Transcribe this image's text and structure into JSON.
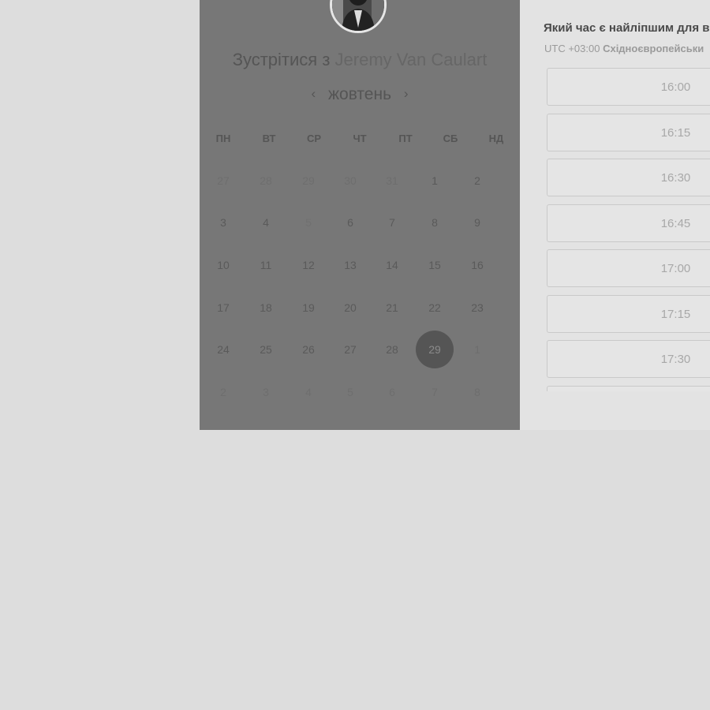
{
  "host": {
    "avatar_alt": "avatar",
    "title_prefix": "Зустрітися з",
    "name": "Jeremy Van Caulart"
  },
  "calendar": {
    "month": "жовтень",
    "prev_icon": "chevron-left-icon",
    "next_icon": "chevron-right-icon",
    "weekdays": [
      "ПН",
      "ВТ",
      "СР",
      "ЧТ",
      "ПТ",
      "СБ",
      "НД"
    ],
    "weeks": [
      [
        {
          "d": "27",
          "s": "muted"
        },
        {
          "d": "28",
          "s": "muted"
        },
        {
          "d": "29",
          "s": "muted"
        },
        {
          "d": "30",
          "s": "muted"
        },
        {
          "d": "31",
          "s": "muted"
        },
        {
          "d": "1",
          "s": ""
        },
        {
          "d": "2",
          "s": ""
        }
      ],
      [
        {
          "d": "3",
          "s": ""
        },
        {
          "d": "4",
          "s": ""
        },
        {
          "d": "5",
          "s": "disabled"
        },
        {
          "d": "6",
          "s": ""
        },
        {
          "d": "7",
          "s": ""
        },
        {
          "d": "8",
          "s": ""
        },
        {
          "d": "9",
          "s": ""
        }
      ],
      [
        {
          "d": "10",
          "s": ""
        },
        {
          "d": "11",
          "s": ""
        },
        {
          "d": "12",
          "s": ""
        },
        {
          "d": "13",
          "s": ""
        },
        {
          "d": "14",
          "s": ""
        },
        {
          "d": "15",
          "s": ""
        },
        {
          "d": "16",
          "s": ""
        }
      ],
      [
        {
          "d": "17",
          "s": ""
        },
        {
          "d": "18",
          "s": ""
        },
        {
          "d": "19",
          "s": ""
        },
        {
          "d": "20",
          "s": ""
        },
        {
          "d": "21",
          "s": ""
        },
        {
          "d": "22",
          "s": ""
        },
        {
          "d": "23",
          "s": ""
        }
      ],
      [
        {
          "d": "24",
          "s": ""
        },
        {
          "d": "25",
          "s": ""
        },
        {
          "d": "26",
          "s": ""
        },
        {
          "d": "27",
          "s": ""
        },
        {
          "d": "28",
          "s": ""
        },
        {
          "d": "29",
          "s": "selected"
        },
        {
          "d": "1",
          "s": "muted"
        }
      ],
      [
        {
          "d": "2",
          "s": "muted"
        },
        {
          "d": "3",
          "s": "muted"
        },
        {
          "d": "4",
          "s": "muted"
        },
        {
          "d": "5",
          "s": "muted"
        },
        {
          "d": "6",
          "s": "muted"
        },
        {
          "d": "7",
          "s": "muted"
        },
        {
          "d": "8",
          "s": "muted"
        }
      ]
    ]
  },
  "times": {
    "question": "Який час є найліпшим для в",
    "tz_offset": "UTC +03:00",
    "tz_name": "Східноєвропейськи",
    "slots": [
      "16:00",
      "16:15",
      "16:30",
      "16:45",
      "17:00",
      "17:15",
      "17:30",
      ""
    ]
  },
  "colors": {
    "overlay_left": "#777777",
    "right_panel": "#e3e3e3",
    "page_bg": "#dddddd",
    "selected_day": "#555555"
  }
}
